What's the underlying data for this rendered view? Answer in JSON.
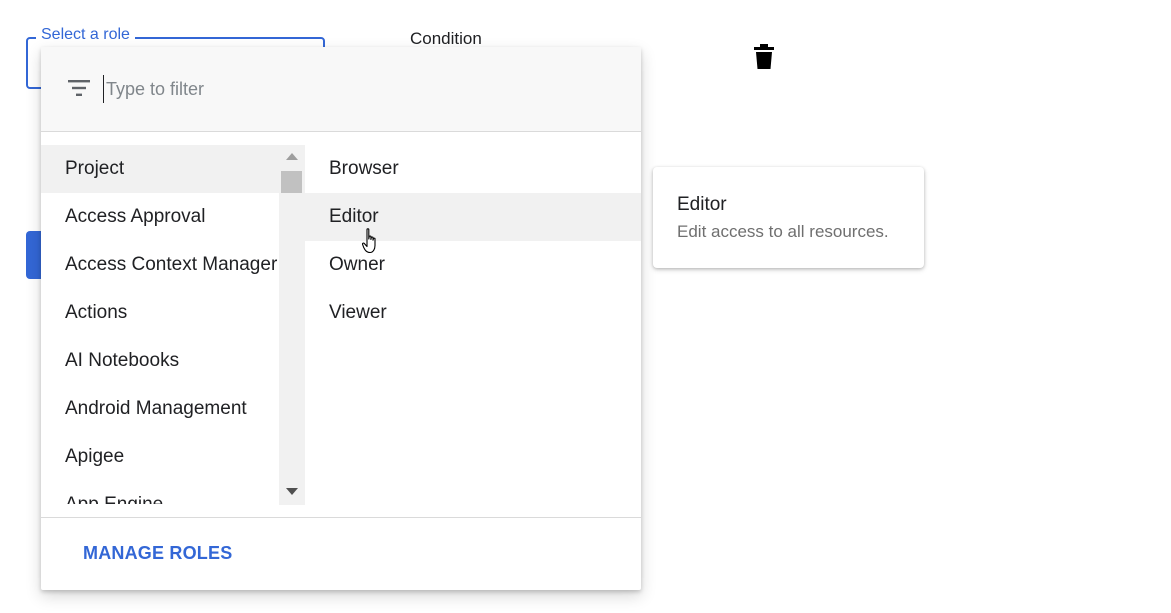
{
  "form": {
    "role_legend": "Select a role",
    "condition_label": "Condition"
  },
  "filter": {
    "placeholder": "Type to filter",
    "value": ""
  },
  "categories": {
    "selected": "Project",
    "items": [
      {
        "label": "Project"
      },
      {
        "label": "Access Approval"
      },
      {
        "label": "Access Context Manager"
      },
      {
        "label": "Actions"
      },
      {
        "label": "AI Notebooks"
      },
      {
        "label": "Android Management"
      },
      {
        "label": "Apigee"
      },
      {
        "label": "App Engine"
      }
    ]
  },
  "roles": {
    "hovered": "Editor",
    "items": [
      {
        "label": "Browser"
      },
      {
        "label": "Editor"
      },
      {
        "label": "Owner"
      },
      {
        "label": "Viewer"
      }
    ]
  },
  "footer": {
    "manage_roles_label": "MANAGE ROLES"
  },
  "tooltip": {
    "title": "Editor",
    "description": "Edit access to all resources."
  },
  "icons": {
    "filter": "filter-list-icon",
    "trash": "delete-icon",
    "cursor": "hand-pointer-icon"
  },
  "colors": {
    "accent": "#3367d6",
    "selected_row": "#f1f1f1",
    "filter_bar_bg": "#f8f8f8",
    "secondary_text": "#6f6f6f"
  }
}
